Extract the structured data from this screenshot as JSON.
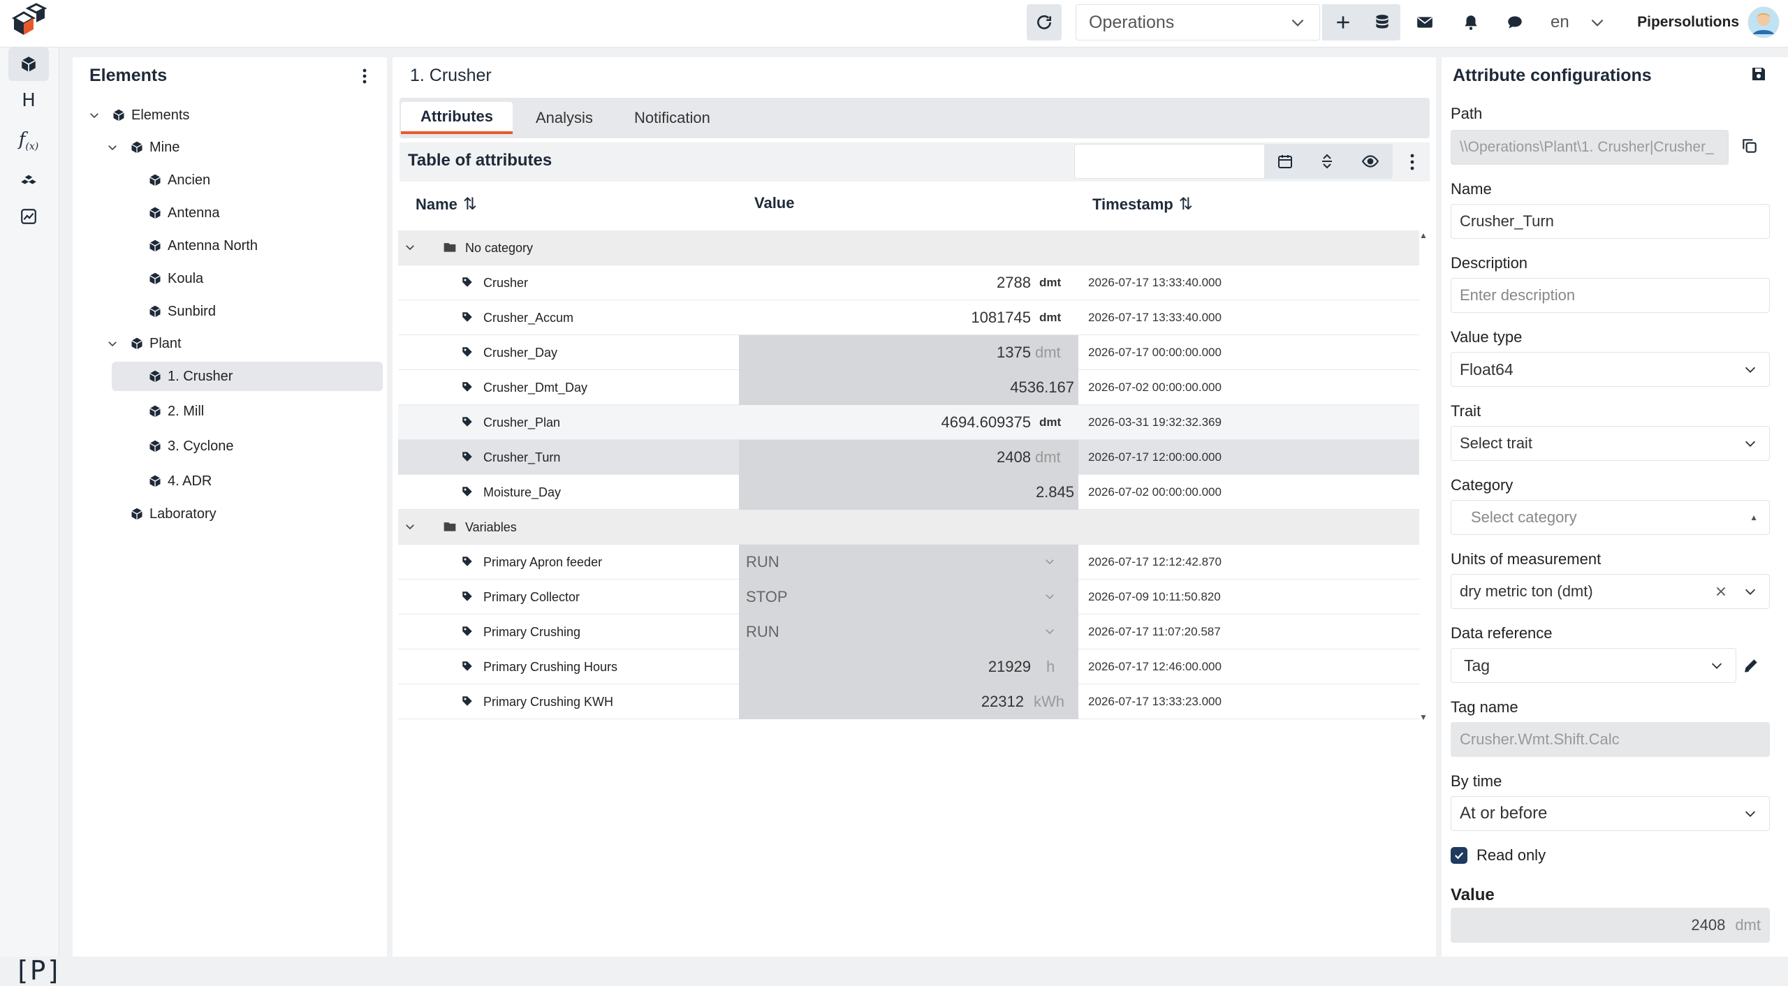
{
  "header": {
    "workspace": "Operations",
    "language": "en",
    "user": "Pipersolutions"
  },
  "elements_panel": {
    "title": "Elements",
    "tree": [
      {
        "label": "Elements",
        "level": 0,
        "expanded": true
      },
      {
        "label": "Mine",
        "level": 1,
        "expanded": true
      },
      {
        "label": "Ancien",
        "level": 2
      },
      {
        "label": "Antenna",
        "level": 2
      },
      {
        "label": "Antenna North",
        "level": 2
      },
      {
        "label": "Koula",
        "level": 2
      },
      {
        "label": "Sunbird",
        "level": 2
      },
      {
        "label": "Plant",
        "level": 1,
        "expanded": true
      },
      {
        "label": "1. Crusher",
        "level": 2,
        "selected": true
      },
      {
        "label": "2. Mill",
        "level": 2
      },
      {
        "label": "3. Cyclone",
        "level": 2
      },
      {
        "label": "4. ADR",
        "level": 2
      },
      {
        "label": "Laboratory",
        "level": 1
      }
    ]
  },
  "main": {
    "title": "1. Crusher",
    "tabs": [
      "Attributes",
      "Analysis",
      "Notification"
    ],
    "active_tab": "Attributes",
    "table_title": "Table of attributes",
    "columns": [
      "Name",
      "Value",
      "Timestamp"
    ],
    "groups": [
      {
        "name": "No category",
        "rows": [
          {
            "name": "Crusher",
            "value": "2788",
            "unit": "dmt",
            "timestamp": "2026-07-17 13:33:40.000"
          },
          {
            "name": "Crusher_Accum",
            "value": "1081745",
            "unit": "dmt",
            "timestamp": "2026-07-17 13:33:40.000"
          },
          {
            "name": "Crusher_Day",
            "value": "1375",
            "unit": "dmt",
            "timestamp": "2026-07-17 00:00:00.000"
          },
          {
            "name": "Crusher_Dmt_Day",
            "value": "4536.167",
            "unit": "",
            "timestamp": "2026-07-02 00:00:00.000"
          },
          {
            "name": "Crusher_Plan",
            "value": "4694.609375",
            "unit": "dmt",
            "timestamp": "2026-03-31 19:32:32.369"
          },
          {
            "name": "Crusher_Turn",
            "value": "2408",
            "unit": "dmt",
            "timestamp": "2026-07-17 12:00:00.000"
          },
          {
            "name": "Moisture_Day",
            "value": "2.845",
            "unit": "",
            "timestamp": "2026-07-02 00:00:00.000"
          }
        ]
      },
      {
        "name": "Variables",
        "rows": [
          {
            "name": "Primary Apron feeder",
            "value": "RUN",
            "unit": "",
            "timestamp": "2026-07-17 12:12:42.870"
          },
          {
            "name": "Primary Collector",
            "value": "STOP",
            "unit": "",
            "timestamp": "2026-07-09 10:11:50.820"
          },
          {
            "name": "Primary Crushing",
            "value": "RUN",
            "unit": "",
            "timestamp": "2026-07-17 11:07:20.587"
          },
          {
            "name": "Primary Crushing Hours",
            "value": "21929",
            "unit": "h",
            "timestamp": "2026-07-17 12:46:00.000"
          },
          {
            "name": "Primary Crushing KWH",
            "value": "22312",
            "unit": "kWh",
            "timestamp": "2026-07-17 13:33:23.000"
          }
        ]
      }
    ]
  },
  "config": {
    "title": "Attribute configurations",
    "path_label": "Path",
    "path_value": "\\\\Operations\\Plant\\1. Crusher|Crusher_",
    "name_label": "Name",
    "name_value": "Crusher_Turn",
    "description_label": "Description",
    "description_placeholder": "Enter description",
    "value_type_label": "Value type",
    "value_type": "Float64",
    "trait_label": "Trait",
    "trait_placeholder": "Select trait",
    "category_label": "Category",
    "category_placeholder": "Select category",
    "uom_label": "Units of measurement",
    "uom_value": "dry metric ton (dmt)",
    "data_ref_label": "Data reference",
    "data_ref_value": "Tag",
    "tag_label": "Tag name",
    "tag_value": "Crusher.Wmt.Shift.Calc",
    "by_time_label": "By time",
    "by_time_value": "At or before",
    "read_only_label": "Read only",
    "read_only": true,
    "value_label": "Value",
    "value": "2408",
    "value_unit": "dmt"
  },
  "colors": {
    "accent": "#e8592a",
    "dark": "#1e2a38",
    "checkbox": "#1e3a5f"
  }
}
